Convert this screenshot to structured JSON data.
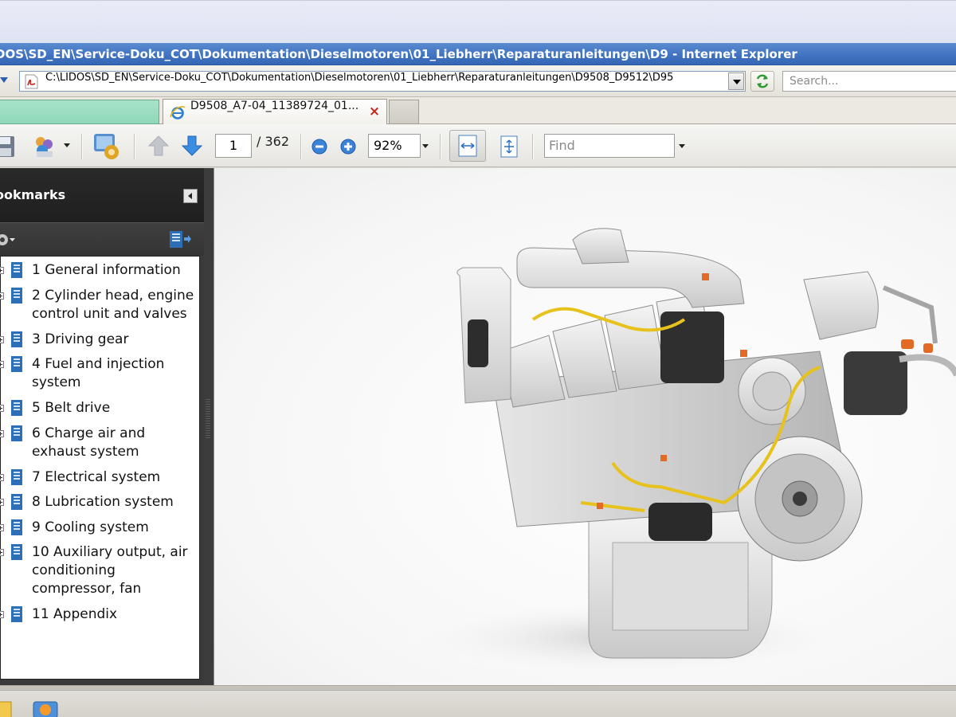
{
  "window": {
    "title": "DOS\\SD_EN\\Service-Doku_COT\\Dokumentation\\Dieselmotoren\\01_Liebherr\\Reparaturanleitungen\\D9 - Internet Explorer"
  },
  "address_bar": {
    "url": "C:\\LIDOS\\SD_EN\\Service-Doku_COT\\Dokumentation\\Dieselmotoren\\01_Liebherr\\Reparaturanleitungen\\D9508_D9512\\D95",
    "search_placeholder": "Search..."
  },
  "tabs": [
    {
      "label": ""
    },
    {
      "label": "D9508_A7-04_11389724_01...",
      "close": "×"
    }
  ],
  "toolbar": {
    "page_current": "1",
    "page_total": "/ 362",
    "zoom": "92%",
    "find_placeholder": "Find"
  },
  "bookmarks": {
    "title": "ookmarks",
    "items": [
      {
        "label": "1 General information"
      },
      {
        "label": "2 Cylinder head, engine control unit and valves"
      },
      {
        "label": "3 Driving gear"
      },
      {
        "label": "4 Fuel and injection system"
      },
      {
        "label": "5 Belt drive"
      },
      {
        "label": "6 Charge air and exhaust system"
      },
      {
        "label": "7 Electrical system"
      },
      {
        "label": "8 Lubrication system"
      },
      {
        "label": "9 Cooling system"
      },
      {
        "label": "10 Auxiliary output, air conditioning compressor, fan"
      },
      {
        "label": "11 Appendix"
      }
    ]
  },
  "icons": {
    "back": "back-arrow-icon",
    "pdf": "pdf-file-icon",
    "refresh": "refresh-icon",
    "ie": "internet-explorer-icon",
    "save": "save-icon",
    "share": "share-icon",
    "settings": "settings-icon",
    "prev_page": "arrow-up-icon",
    "next_page": "arrow-down-icon",
    "zoom_out": "zoom-out-icon",
    "zoom_in": "zoom-in-icon",
    "fit_width": "fit-width-icon",
    "fit_page": "fit-page-icon",
    "bookmark": "bookmark-icon"
  },
  "colors": {
    "title_bar": "#3f72c0",
    "tab_green": "#90d8b8",
    "bookmark_pane": "#3a3a3a",
    "bookmark_icon": "#2c6fb7",
    "engine_wiring": "#e8c21c"
  }
}
